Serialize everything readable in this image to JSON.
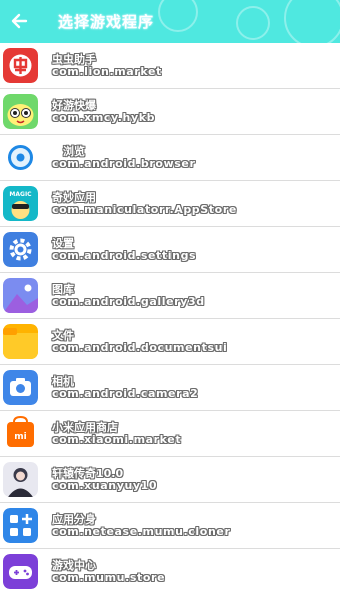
{
  "header": {
    "title": "选择游戏程序",
    "back_icon": "arrow-left-icon",
    "background": "#4fe8e0"
  },
  "apps": [
    {
      "name": "虫虫助手",
      "package": "com.lion.market",
      "icon": "lion-market-icon"
    },
    {
      "name": "好游快爆",
      "package": "com.xmcy.hykb",
      "icon": "hykb-icon"
    },
    {
      "name": "　浏览",
      "package": "com.android.browser",
      "icon": "browser-icon"
    },
    {
      "name": "奇妙应用",
      "package": "com.maniculatorr.AppStore",
      "icon": "magic-app-icon"
    },
    {
      "name": "设置",
      "package": "com.android.settings",
      "icon": "settings-icon"
    },
    {
      "name": "图库",
      "package": "com.android.gallery3d",
      "icon": "gallery-icon"
    },
    {
      "name": "文件",
      "package": "com.android.documentsui",
      "icon": "folder-icon"
    },
    {
      "name": "相机",
      "package": "com.android.camera2",
      "icon": "camera-icon"
    },
    {
      "name": "小米应用商店",
      "package": "com.xiaomi.market",
      "icon": "mi-store-icon"
    },
    {
      "name": "轩辕传奇10.0",
      "package": "com.xuanyuy10",
      "icon": "avatar-icon"
    },
    {
      "name": "应用分身",
      "package": "com.netease.mumu.cloner",
      "icon": "cloner-icon"
    },
    {
      "name": "游戏中心",
      "package": "com.mumu.store",
      "icon": "gamepad-icon"
    }
  ]
}
